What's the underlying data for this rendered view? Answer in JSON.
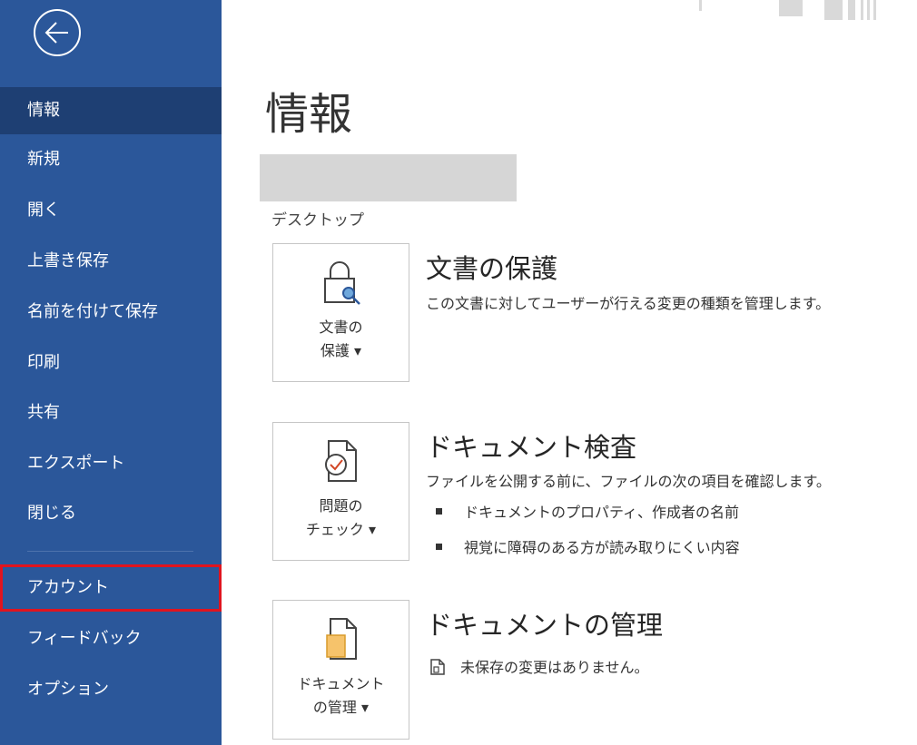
{
  "sidebar": {
    "back_icon": "back-arrow-circle-icon",
    "items": [
      {
        "label": "情報"
      },
      {
        "label": "新規"
      },
      {
        "label": "開く"
      },
      {
        "label": "上書き保存"
      },
      {
        "label": "名前を付けて保存"
      },
      {
        "label": "印刷"
      },
      {
        "label": "共有"
      },
      {
        "label": "エクスポート"
      },
      {
        "label": "閉じる"
      },
      {
        "label": "アカウント"
      },
      {
        "label": "フィードバック"
      },
      {
        "label": "オプション"
      }
    ],
    "active_item": "情報",
    "highlighted_item": "アカウント",
    "colors": {
      "background": "#2b579a",
      "active": "#1e3f73",
      "highlight_border": "#e0141e"
    }
  },
  "main": {
    "title": "情報",
    "location": "デスクトップ",
    "sections": [
      {
        "tile_label_line1": "文書の",
        "tile_label_line2": "保護",
        "tile_icon": "lock-key-icon",
        "heading": "文書の保護",
        "description": "この文書に対してユーザーが行える変更の種類を管理します。"
      },
      {
        "tile_label_line1": "問題の",
        "tile_label_line2": "チェック",
        "tile_icon": "document-check-icon",
        "heading": "ドキュメント検査",
        "description": "ファイルを公開する前に、ファイルの次の項目を確認します。",
        "bullets": [
          "ドキュメントのプロパティ、作成者の名前",
          "視覚に障碍のある方が読み取りにくい内容"
        ]
      },
      {
        "tile_label_line1": "ドキュメント",
        "tile_label_line2": "の管理",
        "tile_icon": "manage-document-icon",
        "heading": "ドキュメントの管理",
        "status": "未保存の変更はありません。",
        "status_icon": "document-icon"
      }
    ],
    "dropdown_glyph": "▾"
  }
}
